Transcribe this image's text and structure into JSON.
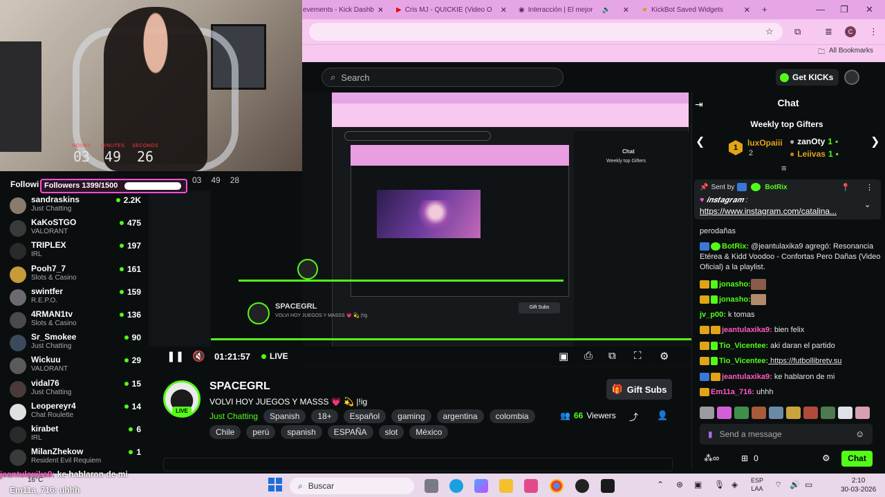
{
  "webcam": {
    "timer": [
      {
        "label": "HOURS",
        "value": "03"
      },
      {
        "label": "MINUTES",
        "value": "49"
      },
      {
        "label": "SECONDS",
        "value": "26"
      }
    ]
  },
  "browser": {
    "tabs": [
      {
        "label": "evements - Kick Dashb"
      },
      {
        "label": "Cris MJ - QUICKIE (Video O"
      },
      {
        "label": "Interacción | El mejor"
      },
      {
        "label": "KickBot Saved Widgets"
      }
    ],
    "bookmarks_label": "All Bookmarks",
    "profile_initial": "C"
  },
  "kick": {
    "search_placeholder": "Search",
    "get_kicks": "Get KICKs"
  },
  "followers_overlay": {
    "title": "Followi",
    "label": "Followers 1399/1500",
    "progress": 0.932
  },
  "following": [
    {
      "name": "sandraskins",
      "category": "Just Chatting",
      "viewers": "2.2K"
    },
    {
      "name": "KaKoSTGO",
      "category": "VALORANT",
      "viewers": "475"
    },
    {
      "name": "TRIPLEX",
      "category": "IRL",
      "viewers": "197"
    },
    {
      "name": "Pooh7_7",
      "category": "Slots & Casino",
      "viewers": "161"
    },
    {
      "name": "swintfer",
      "category": "R.E.P.O.",
      "viewers": "159"
    },
    {
      "name": "4RMAN1tv",
      "category": "Slots & Casino",
      "viewers": "136"
    },
    {
      "name": "Sr_Smokee",
      "category": "Just Chatting",
      "viewers": "90"
    },
    {
      "name": "Wickuu",
      "category": "VALORANT",
      "viewers": "29"
    },
    {
      "name": "vidal76",
      "category": "Just Chatting",
      "viewers": "15"
    },
    {
      "name": "Leopereyr4",
      "category": "Chat Roulette",
      "viewers": "14"
    },
    {
      "name": "kirabet",
      "category": "IRL",
      "viewers": "6"
    },
    {
      "name": "MilanZhekow",
      "category": "Resident Evil Requiem",
      "viewers": "1"
    }
  ],
  "player": {
    "timecode": "01:21:57",
    "live_label": "LIVE",
    "nested_timer": [
      "03",
      "49",
      "28"
    ]
  },
  "stream": {
    "streamer": "SPACEGRL",
    "live_badge": "LIVE",
    "title": "VOLVI HOY JUEGOS Y MASSS 💗 💫 |!ig",
    "category": "Just Chatting",
    "tags_row1": [
      "Spanish",
      "18+",
      "Español",
      "gaming",
      "argentina",
      "colombia"
    ],
    "tags_row2": [
      "Chile",
      "perú",
      "spanish",
      "ESPAÑA",
      "slot",
      "México"
    ],
    "viewers_count": "66",
    "viewers_label": "Viewers",
    "gift_subs": "Gift Subs"
  },
  "chat": {
    "header": "Chat",
    "gifters_title": "Weekly top Gifters",
    "gifters": [
      {
        "rank": "1",
        "name": "luxOpaiii",
        "count": "2"
      },
      {
        "rank": "",
        "name": "zanOty",
        "count": "1"
      },
      {
        "rank": "",
        "name": "Leiivas",
        "count": "1"
      }
    ],
    "pinned": {
      "sent_by": "Sent by",
      "bot": "BotRix",
      "text": "𝒊𝒏𝒔𝒕𝒂𝒈𝒓𝒂𝒎 :",
      "link": "https://www.instagram.com/catalina..."
    },
    "messages": [
      {
        "user": "",
        "text": "perodañas",
        "color": "none"
      },
      {
        "user": "BotRix:",
        "text": " @jeantulaxika9 agregó: Resonancia Etérea & Kidd Voodoo - Confortas Pero Dañas (Video Oficial) a la playlist.",
        "color": "green"
      },
      {
        "user": "jonasho:",
        "text": "",
        "color": "green"
      },
      {
        "user": "jonasho:",
        "text": "",
        "color": "green"
      },
      {
        "user": "jv_p00:",
        "text": " k tomas",
        "color": "green"
      },
      {
        "user": "jeantulaxika9:",
        "text": " bien felix",
        "color": "pink"
      },
      {
        "user": "Tio_Vicentee:",
        "text": " aki daran el partido",
        "color": "green"
      },
      {
        "user": "Tio_Vicentee:",
        "text": " https://futbollibretv.su",
        "color": "green"
      },
      {
        "user": "jeantulaxika9:",
        "text": " ke hablaron de mi",
        "color": "pink"
      },
      {
        "user": "Em11a_716:",
        "text": " uhhh",
        "color": "pink"
      }
    ],
    "input_placeholder": "Send a message",
    "kicks_count": "0",
    "send_label": "Chat"
  },
  "overlay_chat": [
    {
      "user": "jeantulaxika9:",
      "text": "ke hablaron de mi"
    },
    {
      "user": "Em11a_716:",
      "text": "uhhh"
    }
  ],
  "taskbar": {
    "temperature": "16°C",
    "search": "Buscar",
    "lang1": "ESP",
    "lang2": "LAA",
    "time": "2:10",
    "date": "30-03-2026"
  }
}
